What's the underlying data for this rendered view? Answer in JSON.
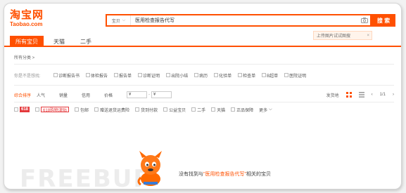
{
  "logo": {
    "cn": "淘宝网",
    "en": "Taobao.com"
  },
  "search": {
    "type": "宝贝",
    "query": "医用检查报告代写",
    "button": "搜 索",
    "hint": "上传图片试试图搜",
    "hint_close": "×"
  },
  "tabs": [
    "所有宝贝",
    "天猫",
    "二手"
  ],
  "breadcrumb": "所有分类 >",
  "filter": {
    "label": "你是不是想找:",
    "items": [
      "诊断报告书",
      "体检报告",
      "报告单",
      "诊断证明",
      "出院小结",
      "病历",
      "化验单",
      "检查单",
      "B超单",
      "医院证明"
    ]
  },
  "sort": {
    "items": [
      "综合排序",
      "人气",
      "销量",
      "信用",
      "价格"
    ],
    "price_from": "¥",
    "price_to": "¥",
    "dash": "-",
    "region": "发货地",
    "page": "1/1"
  },
  "services": {
    "badge_618": "618",
    "badge_618b": "618购物津贴",
    "items": [
      "包邮",
      "赠送退货运费险",
      "货到付款",
      "公益宝贝",
      "二手",
      "天猫",
      "正品保障"
    ],
    "more": "更多"
  },
  "watermark": "FREEBUF",
  "empty": {
    "prefix": "没有找到与",
    "query": "\"医用检查报告代写\"",
    "suffix": "相关的宝贝"
  },
  "colors": {
    "accent": "#ff5000",
    "badge": "#e4393c"
  }
}
